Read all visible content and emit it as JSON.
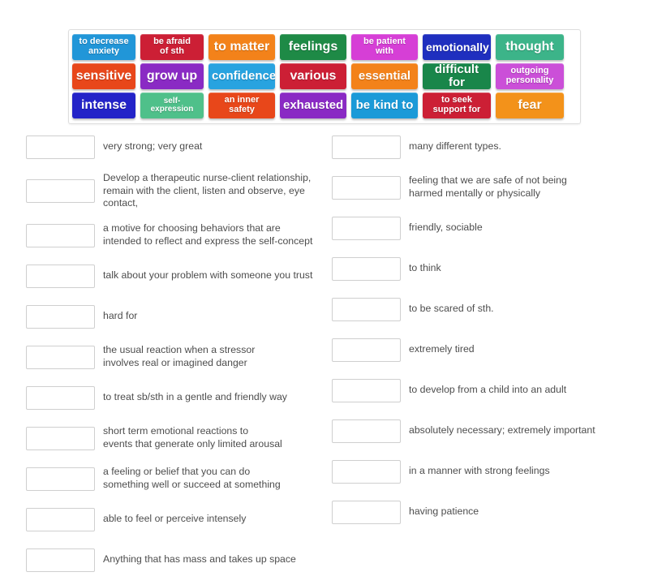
{
  "tile_bank": {
    "name": "word-tile-bank",
    "rows": [
      [
        {
          "label": "to decrease\nanxiety",
          "color": "#2196d8",
          "size": "small"
        },
        {
          "label": "be afraid\nof sth",
          "color": "#cc1f35",
          "size": "small"
        },
        {
          "label": "to matter",
          "color": "#f3821a",
          "size": "large"
        },
        {
          "label": "feelings",
          "color": "#1e8a46",
          "size": "large"
        },
        {
          "label": "be patient\nwith",
          "color": "#d63fd6",
          "size": "small"
        },
        {
          "label": "emotionally",
          "color": "#1f2fbf",
          "size": "medium"
        },
        {
          "label": "thought",
          "color": "#3cb489",
          "size": "large"
        }
      ],
      [
        {
          "label": "sensitive",
          "color": "#e8471a",
          "size": "large"
        },
        {
          "label": "grow up",
          "color": "#8a2ac4",
          "size": "large"
        },
        {
          "label": "confidence",
          "color": "#28a3e0",
          "size": "medium"
        },
        {
          "label": "various",
          "color": "#cc1f35",
          "size": "large"
        },
        {
          "label": "essential",
          "color": "#f3821a",
          "size": "large"
        },
        {
          "label": "difficult for",
          "color": "#19864a",
          "size": "medium"
        },
        {
          "label": "outgoing\npersonality",
          "color": "#cb4fd8",
          "size": "small"
        }
      ],
      [
        {
          "label": "intense",
          "color": "#2323c8",
          "size": "large"
        },
        {
          "label": "self-expression",
          "color": "#4fc08a",
          "size": "tiny"
        },
        {
          "label": "an inner\nsafety",
          "color": "#e8471a",
          "size": "small"
        },
        {
          "label": "exhausted",
          "color": "#8a2ac4",
          "size": "medium"
        },
        {
          "label": "be kind to",
          "color": "#1b9ad8",
          "size": "large"
        },
        {
          "label": "to seek\nsupport for",
          "color": "#cc1f35",
          "size": "small"
        },
        {
          "label": "fear",
          "color": "#f3921a",
          "size": "large"
        }
      ]
    ]
  },
  "answers": {
    "left_column": [
      {
        "box_value": "",
        "definition": "very strong; very great"
      },
      {
        "box_value": "",
        "definition": "Develop a therapeutic nurse-client relationship,\nremain with the client, listen and observe, eye contact,"
      },
      {
        "box_value": "",
        "definition": "a motive for choosing behaviors that are\nintended to reflect and express the self-concept"
      },
      {
        "box_value": "",
        "definition": "talk about your problem with someone you trust"
      },
      {
        "box_value": "",
        "definition": "hard for"
      },
      {
        "box_value": "",
        "definition": "the usual reaction when a stressor\ninvolves real or imagined danger"
      },
      {
        "box_value": "",
        "definition": "to treat sb/sth in a gentle and friendly way"
      },
      {
        "box_value": "",
        "definition": "short term emotional reactions to\nevents that generate only limited arousal"
      },
      {
        "box_value": "",
        "definition": "a feeling or belief that you can do\nsomething well or succeed at something"
      },
      {
        "box_value": "",
        "definition": "able to feel or perceive intensely"
      },
      {
        "box_value": "",
        "definition": "Anything that has mass and takes up space"
      }
    ],
    "right_column": [
      {
        "box_value": "",
        "definition": "many different types."
      },
      {
        "box_value": "",
        "definition": "feeling that we are safe of not being\nharmed mentally or physically"
      },
      {
        "box_value": "",
        "definition": "friendly, sociable"
      },
      {
        "box_value": "",
        "definition": "to think"
      },
      {
        "box_value": "",
        "definition": "to be scared of sth."
      },
      {
        "box_value": "",
        "definition": "extremely tired"
      },
      {
        "box_value": "",
        "definition": "to develop from a child into an adult"
      },
      {
        "box_value": "",
        "definition": "absolutely necessary; extremely important"
      },
      {
        "box_value": "",
        "definition": "in a manner with strong feelings"
      },
      {
        "box_value": "",
        "definition": "having patience"
      }
    ]
  },
  "colors": {
    "page_background": "#ffffff",
    "text": "#4d4d4d",
    "box_border": "#cfcfcf",
    "bank_border": "#dddddd"
  }
}
